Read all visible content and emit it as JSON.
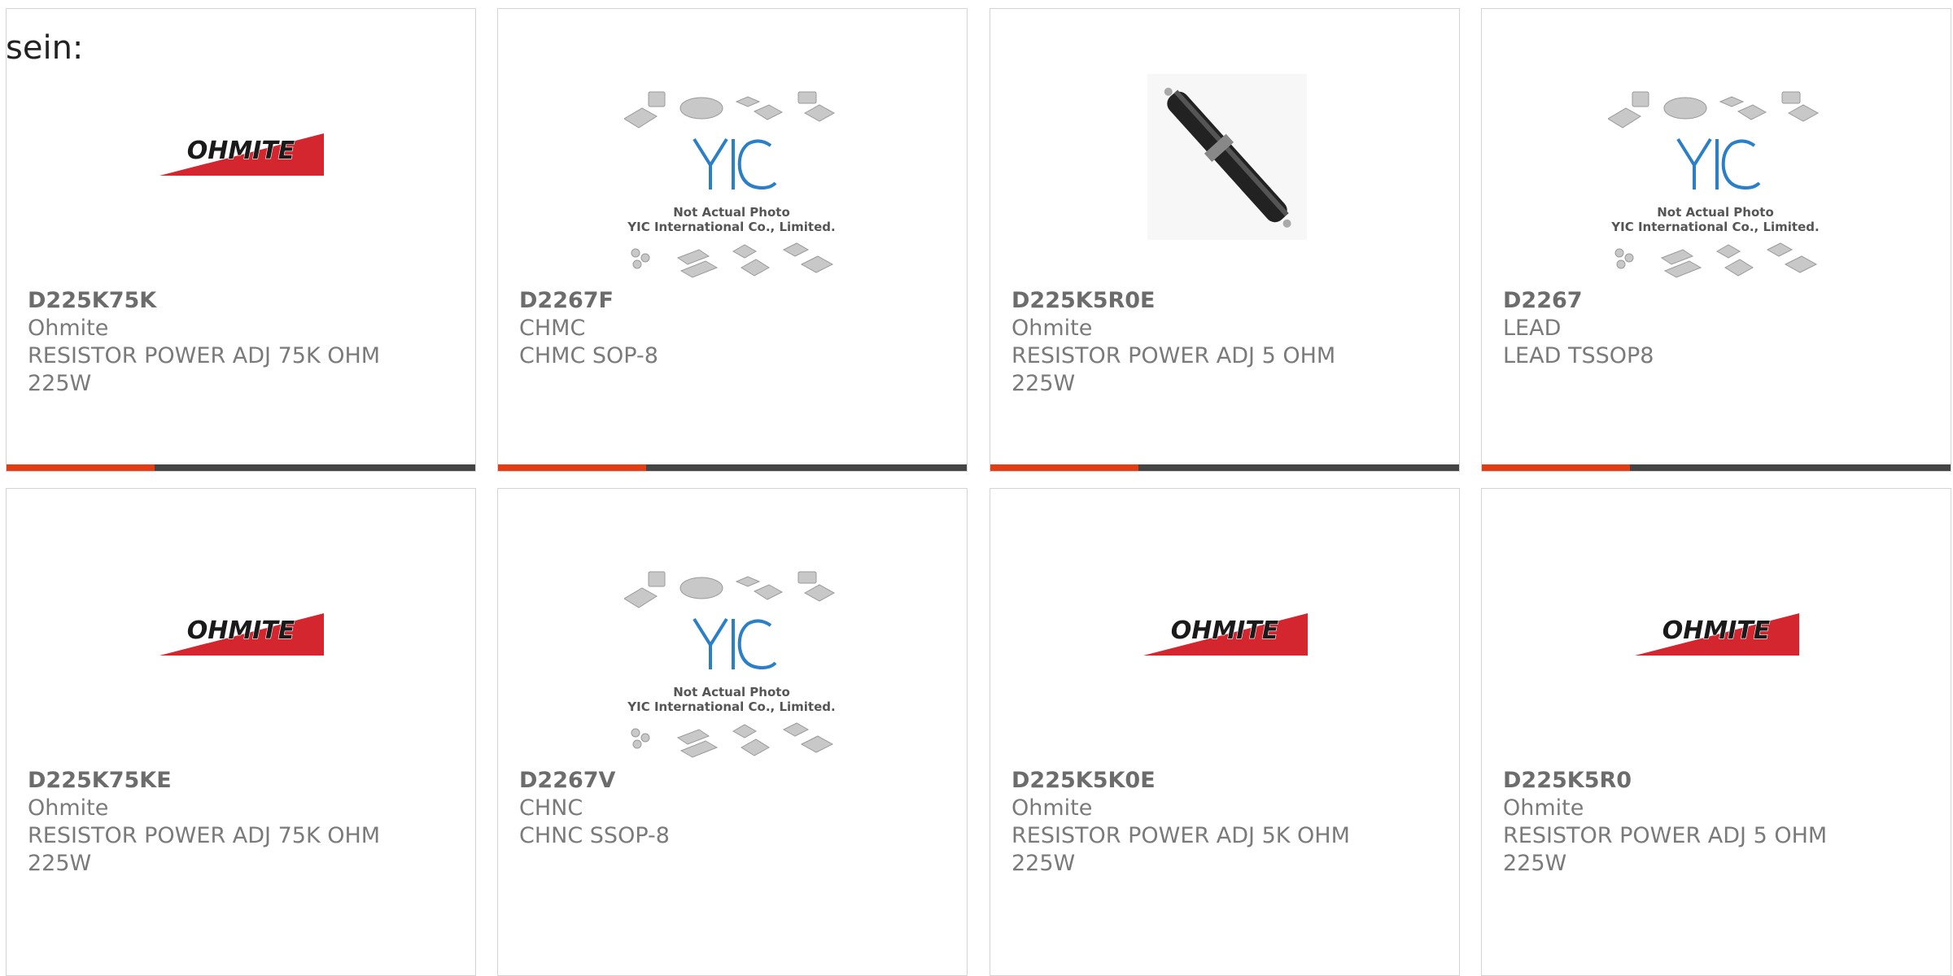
{
  "intro_text": "sein:",
  "colors": {
    "accent": "#e63c14",
    "bar": "#444444",
    "ohmite_red": "#d3262f"
  },
  "logo_text": "OHMITE",
  "placeholder": {
    "line1": "Not Actual Photo",
    "line2": "YIC International Co., Limited.",
    "brand": "YIC"
  },
  "products": [
    {
      "part": "D225K75K",
      "maker": "Ohmite",
      "desc1": "RESISTOR POWER ADJ 75K OHM",
      "desc2": "225W",
      "image": "ohmite-logo"
    },
    {
      "part": "D2267F",
      "maker": "CHMC",
      "desc1": "CHMC SOP-8",
      "desc2": "",
      "image": "yic-placeholder"
    },
    {
      "part": "D225K5R0E",
      "maker": "Ohmite",
      "desc1": "RESISTOR POWER ADJ 5 OHM",
      "desc2": "225W",
      "image": "resistor-photo"
    },
    {
      "part": "D2267",
      "maker": "LEAD",
      "desc1": "LEAD TSSOP8",
      "desc2": "",
      "image": "yic-placeholder"
    },
    {
      "part": "D225K75KE",
      "maker": "Ohmite",
      "desc1": "RESISTOR POWER ADJ 75K OHM",
      "desc2": "225W",
      "image": "ohmite-logo"
    },
    {
      "part": "D2267V",
      "maker": "CHNC",
      "desc1": "CHNC SSOP-8",
      "desc2": "",
      "image": "yic-placeholder"
    },
    {
      "part": "D225K5K0E",
      "maker": "Ohmite",
      "desc1": "RESISTOR POWER ADJ 5K OHM",
      "desc2": "225W",
      "image": "ohmite-logo"
    },
    {
      "part": "D225K5R0",
      "maker": "Ohmite",
      "desc1": "RESISTOR POWER ADJ 5 OHM",
      "desc2": "225W",
      "image": "ohmite-logo"
    }
  ]
}
